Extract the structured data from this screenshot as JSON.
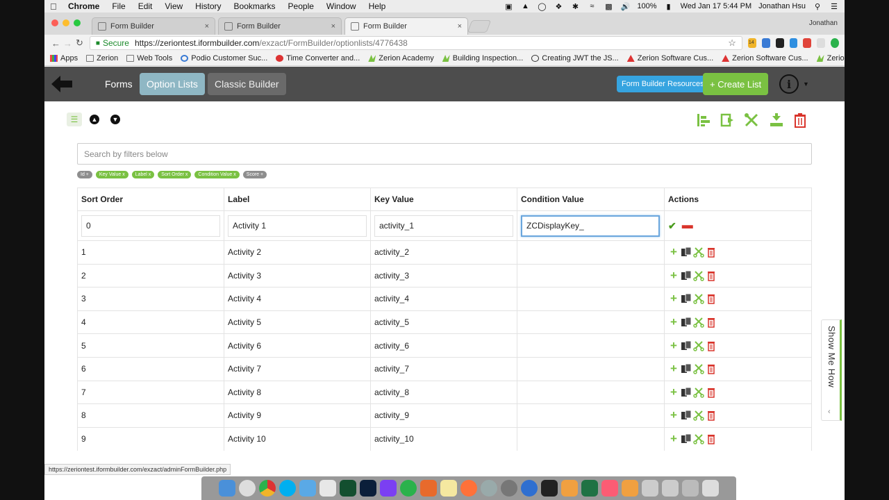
{
  "menubar": {
    "app": "Chrome",
    "menus": [
      "File",
      "Edit",
      "View",
      "History",
      "Bookmarks",
      "People",
      "Window",
      "Help"
    ],
    "battery": "100%",
    "datetime": "Wed Jan 17  5:44 PM",
    "user": "Jonathan Hsu"
  },
  "browser": {
    "tabs": [
      {
        "title": "Form Builder",
        "active": false
      },
      {
        "title": "Form Builder",
        "active": false
      },
      {
        "title": "Form Builder",
        "active": true
      }
    ],
    "profile": "Jonathan",
    "secure_label": "Secure",
    "url_host": "https://zeriontest.iformbuilder.com",
    "url_path": "/exzact/FormBuilder/optionlists/4776438",
    "bookmarks": [
      "Apps",
      "Zerion",
      "Web Tools",
      "Podio Customer Suc...",
      "Time Converter and...",
      "Zerion Academy",
      "Building Inspection...",
      "Creating JWT the JS...",
      "Zerion Software Cus...",
      "Zerion Software Cus...",
      "Zerion Custom Repo..."
    ],
    "calendar_badge": "14"
  },
  "header": {
    "nav": [
      "Forms",
      "Option Lists",
      "Classic Builder"
    ],
    "active_nav": "Option Lists",
    "resources_label": "Form Builder Resources",
    "create_label": "+ Create List",
    "info_glyph": "i"
  },
  "search": {
    "placeholder": "Search by filters below"
  },
  "filters": [
    {
      "label": "Id +",
      "active": false
    },
    {
      "label": "Key Value x",
      "active": true
    },
    {
      "label": "Label x",
      "active": true
    },
    {
      "label": "Sort Order x",
      "active": true
    },
    {
      "label": "Condition Value x",
      "active": true
    },
    {
      "label": "Score +",
      "active": false
    }
  ],
  "table": {
    "columns": [
      "Sort Order",
      "Label",
      "Key Value",
      "Condition Value",
      "Actions"
    ],
    "edit_row": {
      "sort_order": "0",
      "label": "Activity 1",
      "key_value": "activity_1",
      "condition_value": "ZCDisplayKey_"
    },
    "rows": [
      {
        "sort_order": "1",
        "label": "Activity 2",
        "key_value": "activity_2",
        "condition_value": ""
      },
      {
        "sort_order": "2",
        "label": "Activity 3",
        "key_value": "activity_3",
        "condition_value": ""
      },
      {
        "sort_order": "3",
        "label": "Activity 4",
        "key_value": "activity_4",
        "condition_value": ""
      },
      {
        "sort_order": "4",
        "label": "Activity 5",
        "key_value": "activity_5",
        "condition_value": ""
      },
      {
        "sort_order": "5",
        "label": "Activity 6",
        "key_value": "activity_6",
        "condition_value": ""
      },
      {
        "sort_order": "6",
        "label": "Activity 7",
        "key_value": "activity_7",
        "condition_value": ""
      },
      {
        "sort_order": "7",
        "label": "Activity 8",
        "key_value": "activity_8",
        "condition_value": ""
      },
      {
        "sort_order": "8",
        "label": "Activity 9",
        "key_value": "activity_9",
        "condition_value": ""
      },
      {
        "sort_order": "9",
        "label": "Activity 10",
        "key_value": "activity_10",
        "condition_value": ""
      }
    ]
  },
  "show_me_how": "Show Me How",
  "status_url": "https://zeriontest.iformbuilder.com/exzact/adminFormBuilder.php",
  "colors": {
    "accent_green": "#7ac142",
    "header_gray": "#4d4d4d",
    "active_tab_blue": "#8fb7c4",
    "resources_blue": "#36a4e0",
    "delete_red": "#d9342b"
  }
}
